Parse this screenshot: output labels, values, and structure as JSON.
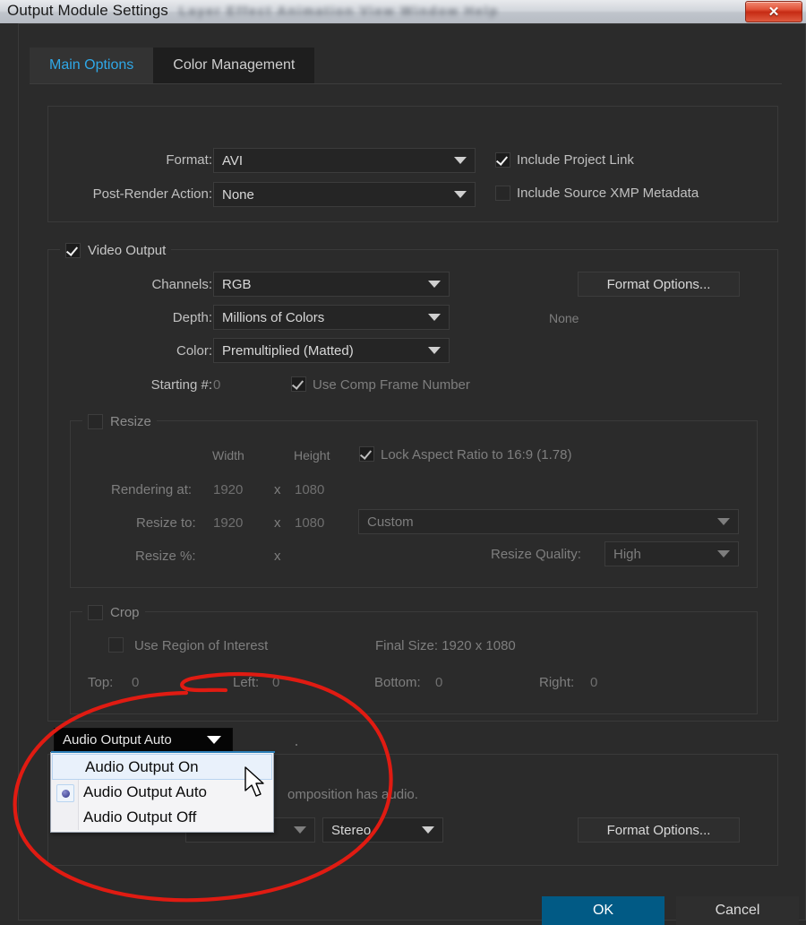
{
  "window": {
    "title": "Output Module Settings",
    "background_menu": "Layer  Effect  Animation  View  Window  Help",
    "close_label": "✕"
  },
  "tabs": [
    {
      "label": "Main Options",
      "active": true
    },
    {
      "label": "Color Management",
      "active": false
    }
  ],
  "format_section": {
    "format_label": "Format:",
    "format_value": "AVI",
    "post_render_label": "Post-Render Action:",
    "post_render_value": "None",
    "include_project_link": "Include Project Link",
    "include_xmp": "Include Source XMP Metadata"
  },
  "video_output": {
    "title": "Video Output",
    "channels_label": "Channels:",
    "channels_value": "RGB",
    "depth_label": "Depth:",
    "depth_value": "Millions of Colors",
    "color_label": "Color:",
    "color_value": "Premultiplied (Matted)",
    "starting_label": "Starting #:",
    "starting_value": "0",
    "use_comp_frame_number": "Use Comp Frame Number",
    "format_options_button": "Format Options...",
    "format_options_status": "None"
  },
  "resize": {
    "title": "Resize",
    "width_header": "Width",
    "height_header": "Height",
    "lock_aspect": "Lock Aspect Ratio to 16:9 (1.78)",
    "rendering_at_label": "Rendering at:",
    "rendering_at_width": "1920",
    "rendering_at_x": "x",
    "rendering_at_height": "1080",
    "resize_to_label": "Resize to:",
    "resize_to_width": "1920",
    "resize_to_x": "x",
    "resize_to_height": "1080",
    "resize_preset": "Custom",
    "resize_pct_label": "Resize %:",
    "resize_pct_x": "x",
    "resize_quality_label": "Resize Quality:",
    "resize_quality_value": "High"
  },
  "crop": {
    "title": "Crop",
    "use_region_of_interest": "Use Region of Interest",
    "final_size": "Final Size: 1920 x 1080",
    "top_label": "Top:",
    "top_value": "0",
    "left_label": "Left:",
    "left_value": "0",
    "bottom_label": "Bottom:",
    "bottom_value": "0",
    "right_label": "Right:",
    "right_value": "0"
  },
  "audio": {
    "selected": "Audio Output Auto",
    "options": [
      {
        "label": "Audio Output On",
        "selected": false,
        "hovered": true
      },
      {
        "label": "Audio Output Auto",
        "selected": true,
        "hovered": false
      },
      {
        "label": "Audio Output Off",
        "selected": false,
        "hovered": false
      }
    ],
    "hint_text_visible": "omposition has audio.",
    "channels_value": "Stereo",
    "format_options_button": "Format Options..."
  },
  "footer": {
    "ok_label": "OK",
    "cancel_label": "Cancel",
    "ok_color": "#015a85"
  }
}
